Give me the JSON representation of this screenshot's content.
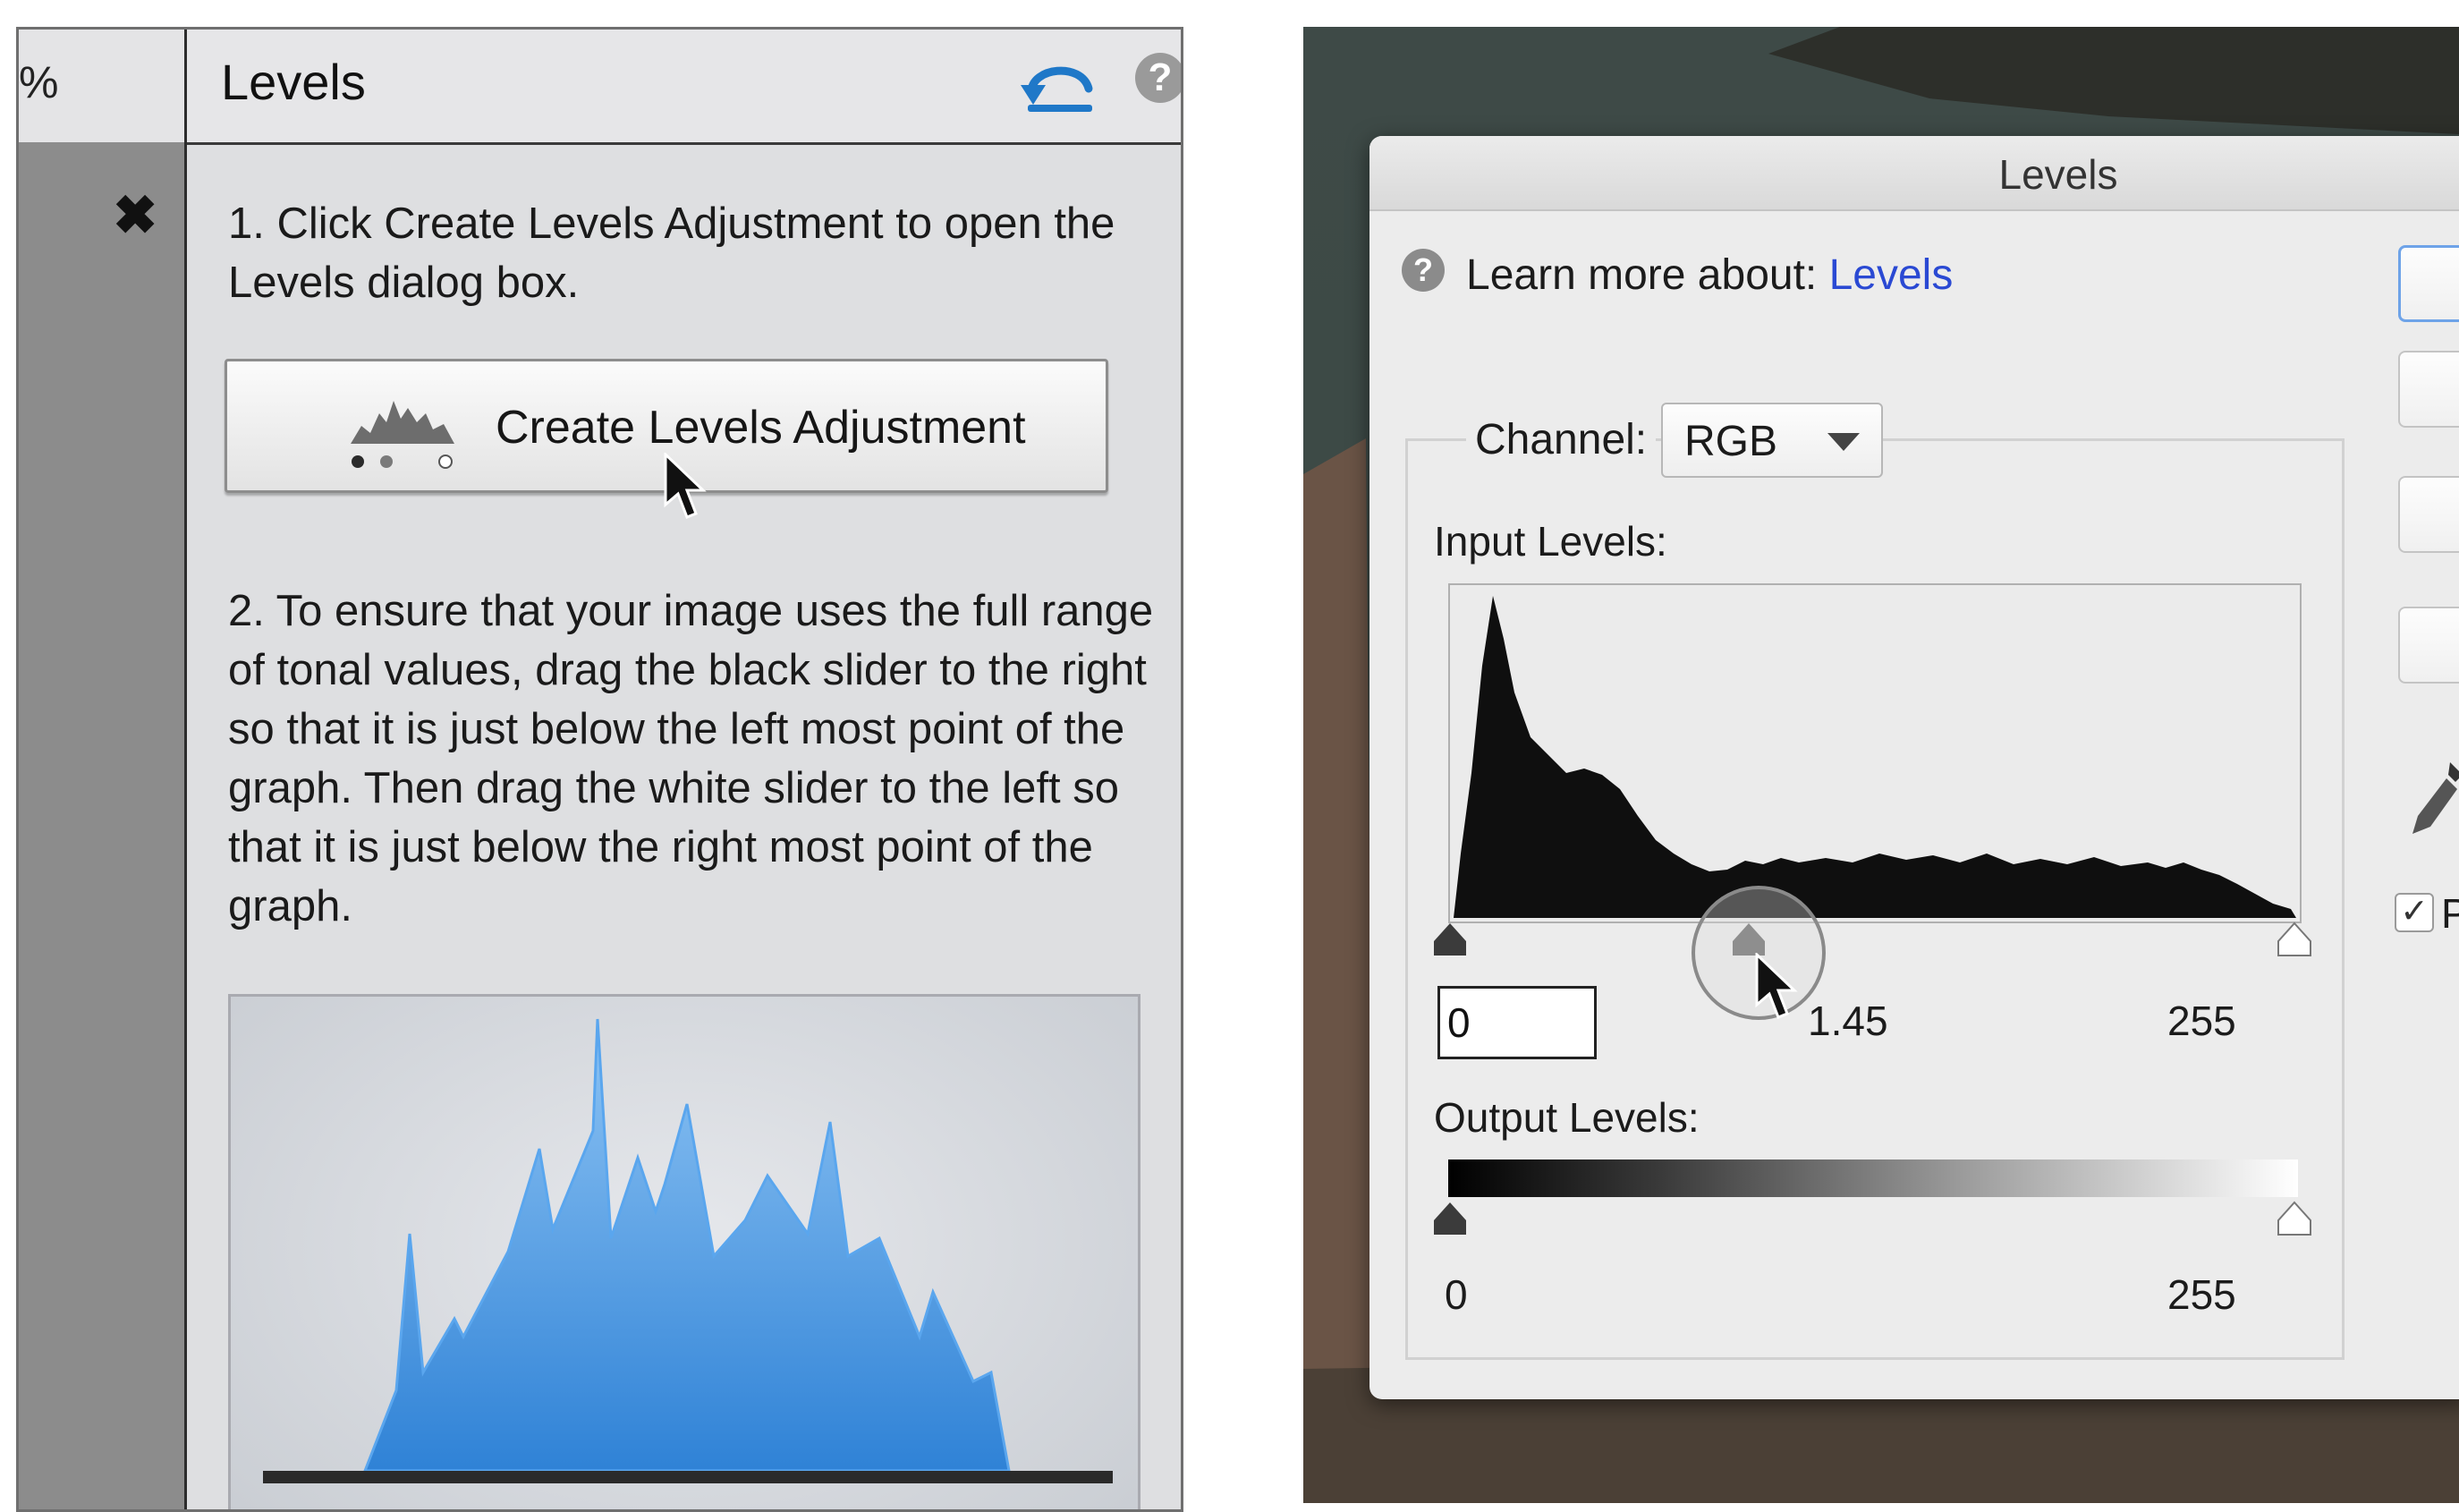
{
  "left_panel": {
    "gutter_glyph": "%",
    "close_glyph": "✖",
    "title": "Levels",
    "help_glyph": "?",
    "step1": "1. Click Create Levels Adjustment to open the Levels dialog box.",
    "create_button_label": "Create Levels Adjustment",
    "step2": "2. To ensure that your image uses the full range of tonal values, drag the black slider to the right so that it is just below the left most point of the graph. Then drag the white slider to the left so that it is just below the right most point of the graph.",
    "preview_histogram_color": "#3e8fe0"
  },
  "dialog": {
    "title": "Levels",
    "help_glyph": "?",
    "learn_prefix": "Learn more about: ",
    "learn_link": "Levels",
    "channel_label": "Channel:",
    "channel_value": "RGB",
    "input_levels_label": "Input Levels:",
    "input_black": "0",
    "input_gamma": "1.45",
    "input_white": "255",
    "output_levels_label": "Output Levels:",
    "output_black": "0",
    "output_white": "255",
    "preview_checked": true,
    "preview_check_glyph": "✓",
    "preview_label": "Preview",
    "link_color": "#2a49d3",
    "accent_color": "#6ea3e8"
  }
}
